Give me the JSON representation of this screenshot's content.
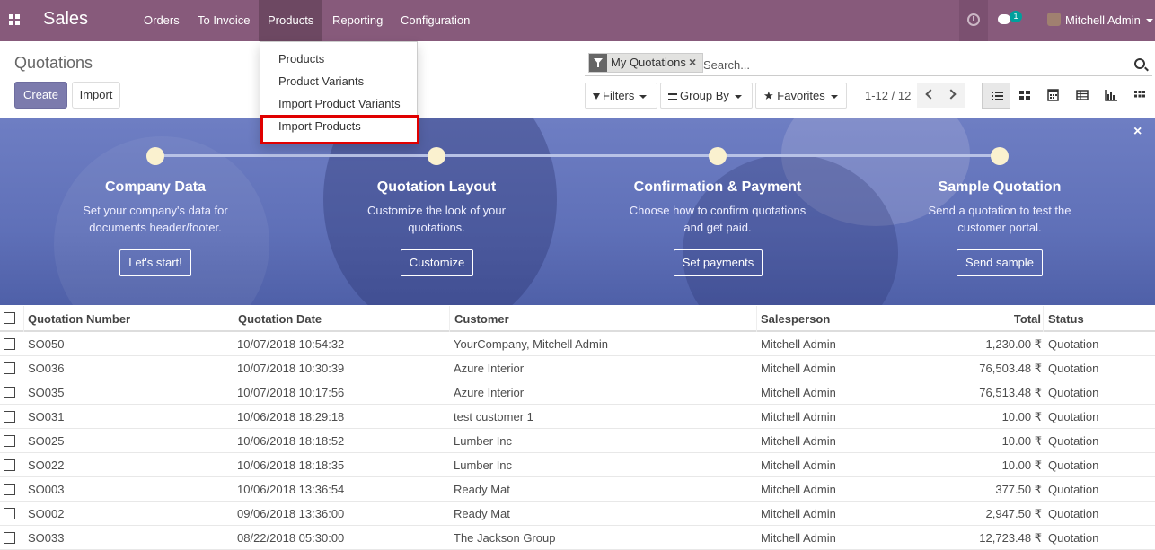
{
  "navbar": {
    "brand": "Sales",
    "menus": [
      "Orders",
      "To Invoice",
      "Products",
      "Reporting",
      "Configuration"
    ],
    "active_menu": "Products",
    "chat_badge": "1",
    "user": "Mitchell Admin",
    "bg_color": "#875a7b"
  },
  "control_panel": {
    "title": "Quotations",
    "create_label": "Create",
    "import_label": "Import",
    "facet_label": "My Quotations",
    "search_placeholder": "Search...",
    "filters_label": "Filters",
    "groupby_label": "Group By",
    "favorites_label": "Favorites",
    "pager": "1-12 / 12",
    "views": [
      "list-view-icon",
      "kanban-view-icon",
      "calendar-view-icon",
      "pivot-view-icon",
      "graph-view-icon",
      "grid-view-icon"
    ]
  },
  "products_dropdown": {
    "items": [
      "Products",
      "Product Variants",
      "Import Product Variants",
      "Import Products"
    ],
    "highlighted": "Import Products",
    "highlight_color": "#e00000"
  },
  "banner": {
    "steps": [
      {
        "title": "Company Data",
        "desc_line1": "Set your company's data for",
        "desc_line2": "documents header/footer.",
        "button": "Let's start!"
      },
      {
        "title": "Quotation Layout",
        "desc_line1": "Customize the look of your",
        "desc_line2": "quotations.",
        "button": "Customize"
      },
      {
        "title": "Confirmation & Payment",
        "desc_line1": "Choose how to confirm quotations",
        "desc_line2": "and get paid.",
        "button": "Set payments"
      },
      {
        "title": "Sample Quotation",
        "desc_line1": "Send a quotation to test the",
        "desc_line2": "customer portal.",
        "button": "Send sample"
      }
    ],
    "close": "×"
  },
  "table": {
    "columns": [
      "Quotation Number",
      "Quotation Date",
      "Customer",
      "Salesperson",
      "Total",
      "Status"
    ],
    "rows": [
      {
        "number": "SO050",
        "date": "10/07/2018 10:54:32",
        "customer": "YourCompany, Mitchell Admin",
        "salesperson": "Mitchell Admin",
        "total": "1,230.00 ₹",
        "status": "Quotation"
      },
      {
        "number": "SO036",
        "date": "10/07/2018 10:30:39",
        "customer": "Azure Interior",
        "salesperson": "Mitchell Admin",
        "total": "76,503.48 ₹",
        "status": "Quotation"
      },
      {
        "number": "SO035",
        "date": "10/07/2018 10:17:56",
        "customer": "Azure Interior",
        "salesperson": "Mitchell Admin",
        "total": "76,513.48 ₹",
        "status": "Quotation"
      },
      {
        "number": "SO031",
        "date": "10/06/2018 18:29:18",
        "customer": "test customer 1",
        "salesperson": "Mitchell Admin",
        "total": "10.00 ₹",
        "status": "Quotation"
      },
      {
        "number": "SO025",
        "date": "10/06/2018 18:18:52",
        "customer": "Lumber Inc",
        "salesperson": "Mitchell Admin",
        "total": "10.00 ₹",
        "status": "Quotation"
      },
      {
        "number": "SO022",
        "date": "10/06/2018 18:18:35",
        "customer": "Lumber Inc",
        "salesperson": "Mitchell Admin",
        "total": "10.00 ₹",
        "status": "Quotation"
      },
      {
        "number": "SO003",
        "date": "10/06/2018 13:36:54",
        "customer": "Ready Mat",
        "salesperson": "Mitchell Admin",
        "total": "377.50 ₹",
        "status": "Quotation"
      },
      {
        "number": "SO002",
        "date": "09/06/2018 13:36:00",
        "customer": "Ready Mat",
        "salesperson": "Mitchell Admin",
        "total": "2,947.50 ₹",
        "status": "Quotation"
      },
      {
        "number": "SO033",
        "date": "08/22/2018 05:30:00",
        "customer": "The Jackson Group",
        "salesperson": "Mitchell Admin",
        "total": "12,723.48 ₹",
        "status": "Quotation"
      }
    ]
  }
}
